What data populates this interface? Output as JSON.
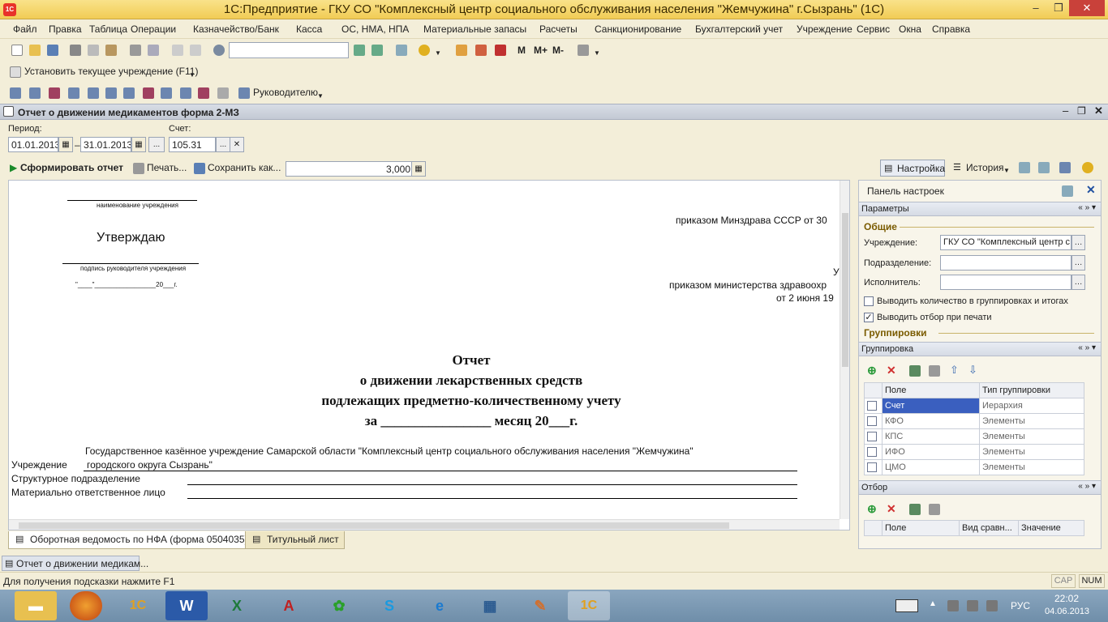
{
  "window": {
    "title": "1С:Предприятие - ГКУ СО \"Комплексный центр социального обслуживания населения \"Жемчужина\" г.Сызрань\" (1С)",
    "logo": "1С",
    "minimize": "–",
    "restore": "❐",
    "close": "✕"
  },
  "menu": [
    "Файл",
    "Правка",
    "Таблица",
    "Операции",
    "Казначейство/Банк",
    "Касса",
    "ОС, НМА, НПА",
    "Материальные запасы",
    "Расчеты",
    "Санкционирование",
    "Бухгалтерский учет",
    "Учреждение",
    "Сервис",
    "Окна",
    "Справка"
  ],
  "toolbar": {
    "m": "M",
    "mplus": "M+",
    "mminus": "M-"
  },
  "toolbar2": {
    "set_institution": "Установить текущее учреждение (F11)"
  },
  "toolbar3": {
    "manager": "Руководителю"
  },
  "document": {
    "title": "Отчет о движении медикаментов форма 2-МЗ"
  },
  "form": {
    "period_label": "Период:",
    "date_from": "01.01.2013",
    "dash": "–",
    "date_to": "31.01.2013",
    "ellipsis": "...",
    "account_label": "Счет:",
    "account": "105.31",
    "clear": "✕"
  },
  "commands": {
    "generate": "Сформировать отчет",
    "print": "Печать...",
    "save": "Сохранить как...",
    "scale": "3,000",
    "settings": "Настройка",
    "history": "История"
  },
  "report": {
    "inst_name_caption": "наименование учреждения",
    "approve": "Утверждаю",
    "signature_caption": "подпись руководителя учреждения",
    "date_line": "\"____\"_________________20___г.",
    "order1": "приказом Минздрава СССР от 30",
    "u": "У",
    "order2": "приказом министерства здравоохр",
    "order3": "от 2 июня 19",
    "heading1": "Отчет",
    "heading2": "о движении лекарственных средств",
    "heading3": "подлежащих предметно-количественному учету",
    "heading4": "за ________________ месяц 20___г.",
    "inst_value1": "Государственное казённое учреждение Самарской области \"Комплексный центр социального обслуживания населения \"Жемчужина\"",
    "inst_label": "Учреждение",
    "inst_value2": "городского округа Сызрань\"",
    "dept_label": "Структурное подразделение",
    "resp_label": "Материально ответственное лицо"
  },
  "tabs": [
    "Оборотная ведомость по НФА (форма 0504035)",
    "Титульный лист"
  ],
  "panel": {
    "title": "Панель настроек",
    "params": "Параметры",
    "general": "Общие",
    "inst_label": "Учреждение:",
    "inst_value": "ГКУ СО \"Комплексный центр с",
    "dept_label": "Подразделение:",
    "exec_label": "Исполнитель:",
    "opt1": "Выводить количество в группировках и итогах",
    "opt2": "Выводить отбор при печати",
    "groupings": "Группировки",
    "grouping": "Группировка",
    "col_field": "Поле",
    "col_type": "Тип группировки",
    "rows": [
      {
        "field": "Счет",
        "type": "Иерархия"
      },
      {
        "field": "КФО",
        "type": "Элементы"
      },
      {
        "field": "КПС",
        "type": "Элементы"
      },
      {
        "field": "ИФО",
        "type": "Элементы"
      },
      {
        "field": "ЦМО",
        "type": "Элементы"
      }
    ],
    "filter": "Отбор",
    "f_col_field": "Поле",
    "f_col_cmp": "Вид сравн...",
    "f_col_value": "Значение"
  },
  "window_tab": "Отчет о движении медикам...",
  "status": {
    "hint": "Для получения подсказки нажмите F1",
    "cap": "CAP",
    "num": "NUM"
  },
  "taskbar": {
    "lang": "РУС",
    "time": "22:02",
    "date": "04.06.2013"
  }
}
